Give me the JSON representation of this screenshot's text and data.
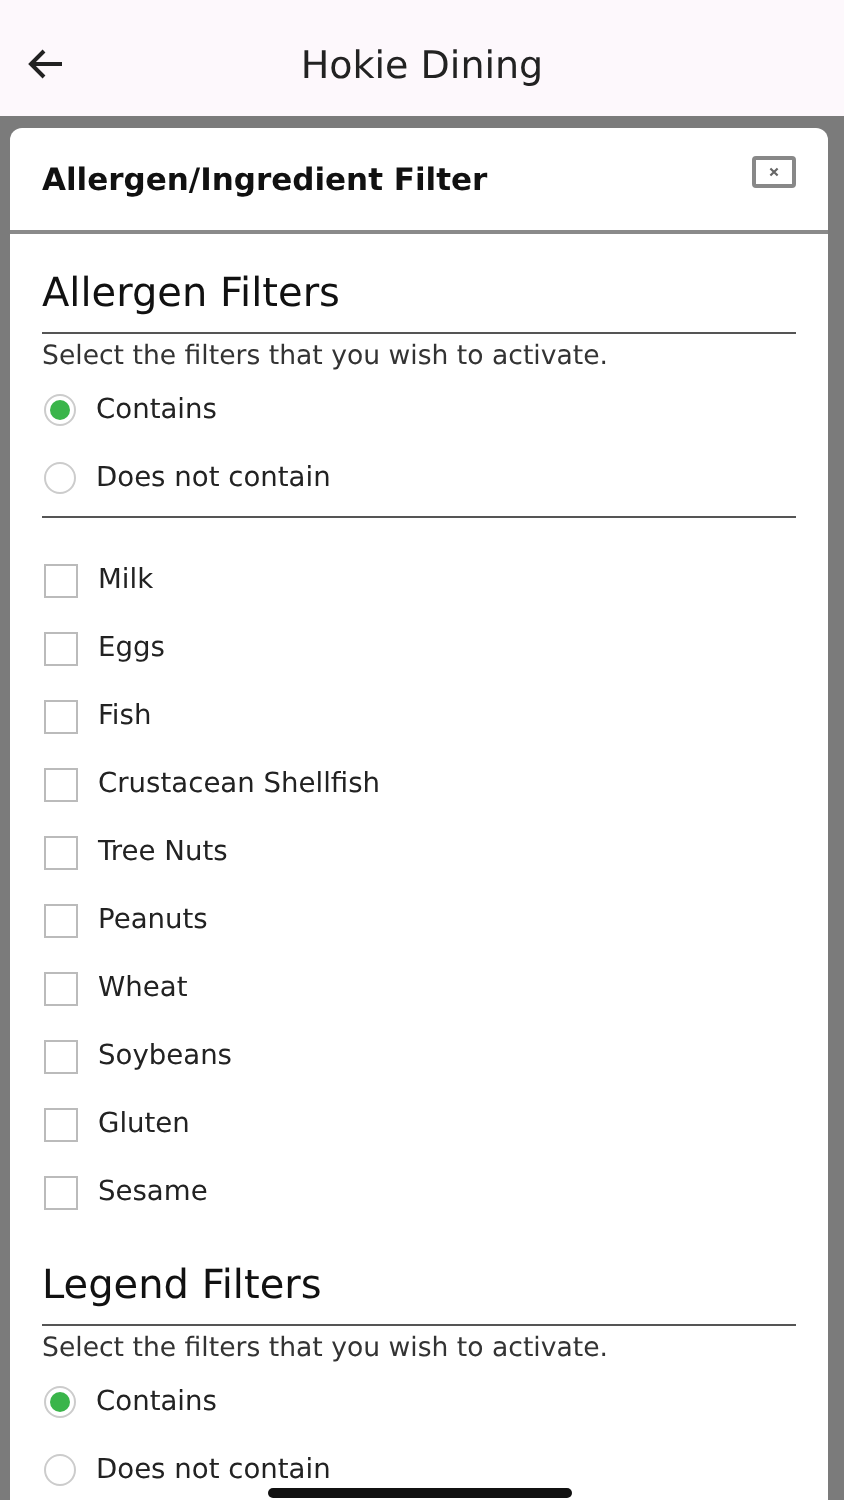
{
  "app_bar": {
    "title": "Hokie Dining"
  },
  "dialog": {
    "title": "Allergen/Ingredient Filter",
    "sections": [
      {
        "heading": "Allergen Filters",
        "instruction": "Select the filters that you wish to activate.",
        "radios": [
          {
            "label": "Contains",
            "selected": true
          },
          {
            "label": "Does not contain",
            "selected": false
          }
        ],
        "checkboxes": [
          {
            "label": "Milk",
            "checked": false
          },
          {
            "label": "Eggs",
            "checked": false
          },
          {
            "label": "Fish",
            "checked": false
          },
          {
            "label": "Crustacean Shellfish",
            "checked": false
          },
          {
            "label": "Tree Nuts",
            "checked": false
          },
          {
            "label": "Peanuts",
            "checked": false
          },
          {
            "label": "Wheat",
            "checked": false
          },
          {
            "label": "Soybeans",
            "checked": false
          },
          {
            "label": "Gluten",
            "checked": false
          },
          {
            "label": "Sesame",
            "checked": false
          }
        ]
      },
      {
        "heading": "Legend Filters",
        "instruction": "Select the filters that you wish to activate.",
        "radios": [
          {
            "label": "Contains",
            "selected": true
          },
          {
            "label": "Does not contain",
            "selected": false
          }
        ]
      }
    ]
  }
}
